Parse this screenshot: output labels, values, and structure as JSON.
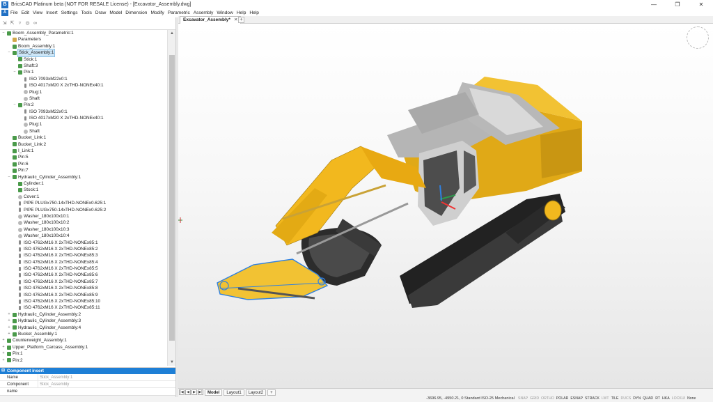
{
  "window": {
    "title": "BricsCAD Platinum beta (NOT FOR RESALE License) - [Excavator_Assembly.dwg]",
    "minimize": "—",
    "maximize": "❐",
    "close": "✕"
  },
  "menu": [
    "File",
    "Edit",
    "View",
    "Insert",
    "Settings",
    "Tools",
    "Draw",
    "Model",
    "Dimension",
    "Modify",
    "Parametric",
    "Assembly",
    "Window",
    "Help",
    "Help"
  ],
  "tree": {
    "rows": [
      {
        "label": "Boom_Assembly_Parametric:1",
        "depth": 0,
        "toggle": "−",
        "icon": "asm"
      },
      {
        "label": "Parameters",
        "depth": 1,
        "toggle": "",
        "icon": "folder"
      },
      {
        "label": "Boom_Assembly:1",
        "depth": 1,
        "toggle": "",
        "icon": "asm"
      },
      {
        "label": "Stick_Assembly:1",
        "depth": 1,
        "toggle": "−",
        "icon": "asm",
        "selected": true
      },
      {
        "label": "Stick:1",
        "depth": 2,
        "toggle": "",
        "icon": "asm"
      },
      {
        "label": "Shaft:3",
        "depth": 2,
        "toggle": "",
        "icon": "asm"
      },
      {
        "label": "Pin:1",
        "depth": 2,
        "toggle": "−",
        "icon": "asm"
      },
      {
        "label": "ISO 7093xM22x0:1",
        "depth": 3,
        "toggle": "",
        "icon": "bolt"
      },
      {
        "label": "ISO 4017xM20 X 2xTHD-NONEx40:1",
        "depth": 3,
        "toggle": "",
        "icon": "bolt"
      },
      {
        "label": "Plug:1",
        "depth": 3,
        "toggle": "",
        "icon": "part"
      },
      {
        "label": "Shaft",
        "depth": 3,
        "toggle": "",
        "icon": "part"
      },
      {
        "label": "Pin:2",
        "depth": 2,
        "toggle": "−",
        "icon": "asm"
      },
      {
        "label": "ISO 7093xM22x0:1",
        "depth": 3,
        "toggle": "",
        "icon": "bolt"
      },
      {
        "label": "ISO 4017xM20 X 2xTHD-NONEx40:1",
        "depth": 3,
        "toggle": "",
        "icon": "bolt"
      },
      {
        "label": "Plug:1",
        "depth": 3,
        "toggle": "",
        "icon": "part"
      },
      {
        "label": "Shaft",
        "depth": 3,
        "toggle": "",
        "icon": "part"
      },
      {
        "label": "Bucket_Link:1",
        "depth": 1,
        "toggle": "",
        "icon": "asm"
      },
      {
        "label": "Bucket_Link:2",
        "depth": 1,
        "toggle": "",
        "icon": "asm"
      },
      {
        "label": "I_Link:1",
        "depth": 1,
        "toggle": "",
        "icon": "asm"
      },
      {
        "label": "Pin:5",
        "depth": 1,
        "toggle": "",
        "icon": "asm"
      },
      {
        "label": "Pin:6",
        "depth": 1,
        "toggle": "",
        "icon": "asm"
      },
      {
        "label": "Pin:7",
        "depth": 1,
        "toggle": "",
        "icon": "asm"
      },
      {
        "label": "Hydraulic_Cylinder_Assembly:1",
        "depth": 1,
        "toggle": "−",
        "icon": "asm"
      },
      {
        "label": "Cylinder:1",
        "depth": 2,
        "toggle": "",
        "icon": "asm"
      },
      {
        "label": "Stock:1",
        "depth": 2,
        "toggle": "",
        "icon": "asm"
      },
      {
        "label": "Cover:1",
        "depth": 2,
        "toggle": "",
        "icon": "part"
      },
      {
        "label": "PIPE PLUGx750-14xTHD-NONEx0.625:1",
        "depth": 2,
        "toggle": "",
        "icon": "bolt"
      },
      {
        "label": "PIPE PLUGx750-14xTHD-NONEx0.625:2",
        "depth": 2,
        "toggle": "",
        "icon": "bolt"
      },
      {
        "label": "Washer_180x100x10:1",
        "depth": 2,
        "toggle": "",
        "icon": "part"
      },
      {
        "label": "Washer_180x100x10:2",
        "depth": 2,
        "toggle": "",
        "icon": "part"
      },
      {
        "label": "Washer_180x100x10:3",
        "depth": 2,
        "toggle": "",
        "icon": "part"
      },
      {
        "label": "Washer_180x100x10:4",
        "depth": 2,
        "toggle": "",
        "icon": "part"
      },
      {
        "label": "ISO 4762xM16 X 2xTHD-NONEx85:1",
        "depth": 2,
        "toggle": "",
        "icon": "bolt"
      },
      {
        "label": "ISO 4762xM16 X 2xTHD-NONEx85:2",
        "depth": 2,
        "toggle": "",
        "icon": "bolt"
      },
      {
        "label": "ISO 4762xM16 X 2xTHD-NONEx85:3",
        "depth": 2,
        "toggle": "",
        "icon": "bolt"
      },
      {
        "label": "ISO 4762xM16 X 2xTHD-NONEx85:4",
        "depth": 2,
        "toggle": "",
        "icon": "bolt"
      },
      {
        "label": "ISO 4762xM16 X 2xTHD-NONEx85:5",
        "depth": 2,
        "toggle": "",
        "icon": "bolt"
      },
      {
        "label": "ISO 4762xM16 X 2xTHD-NONEx85:6",
        "depth": 2,
        "toggle": "",
        "icon": "bolt"
      },
      {
        "label": "ISO 4762xM16 X 2xTHD-NONEx85:7",
        "depth": 2,
        "toggle": "",
        "icon": "bolt"
      },
      {
        "label": "ISO 4762xM16 X 2xTHD-NONEx85:8",
        "depth": 2,
        "toggle": "",
        "icon": "bolt"
      },
      {
        "label": "ISO 4762xM16 X 2xTHD-NONEx85:9",
        "depth": 2,
        "toggle": "",
        "icon": "bolt"
      },
      {
        "label": "ISO 4762xM16 X 2xTHD-NONEx85:10",
        "depth": 2,
        "toggle": "",
        "icon": "bolt"
      },
      {
        "label": "ISO 4762xM16 X 2xTHD-NONEx85:11",
        "depth": 2,
        "toggle": "",
        "icon": "bolt"
      },
      {
        "label": "Hydraulic_Cylinder_Assembly:2",
        "depth": 1,
        "toggle": "+",
        "icon": "asm"
      },
      {
        "label": "Hydraulic_Cylinder_Assembly:3",
        "depth": 1,
        "toggle": "+",
        "icon": "asm"
      },
      {
        "label": "Hydraulic_Cylinder_Assembly:4",
        "depth": 1,
        "toggle": "+",
        "icon": "asm"
      },
      {
        "label": "Bucket_Assembly:1",
        "depth": 1,
        "toggle": "+",
        "icon": "asm"
      },
      {
        "label": "Counterweight_Assembly:1",
        "depth": 0,
        "toggle": "+",
        "icon": "asm"
      },
      {
        "label": "Upper_Platform_Carcass_Assembly:1",
        "depth": 0,
        "toggle": "+",
        "icon": "asm"
      },
      {
        "label": "Pin:1",
        "depth": 0,
        "toggle": "+",
        "icon": "asm"
      },
      {
        "label": "Pin:2",
        "depth": 0,
        "toggle": "+",
        "icon": "asm"
      }
    ]
  },
  "properties": {
    "header": "Component insert",
    "rows": [
      {
        "key": "Name",
        "value": "Stick_Assembly:1"
      },
      {
        "key": "Component name",
        "value": "Stick_Assembly"
      }
    ]
  },
  "document_tab": {
    "label": "Excavator_Assembly*",
    "close": "✕",
    "add": "+"
  },
  "layouts": [
    "Model",
    "Layout1",
    "Layout2"
  ],
  "layout_add": "+",
  "status": {
    "coords": "-3696.95, -4950.21, 0   Standard   ISO-25   Mechanical",
    "toggles": [
      {
        "label": "SNAP",
        "on": false
      },
      {
        "label": "GRID",
        "on": false
      },
      {
        "label": "ORTHO",
        "on": false
      },
      {
        "label": "POLAR",
        "on": true
      },
      {
        "label": "ESNAP",
        "on": true
      },
      {
        "label": "STRACK",
        "on": true
      },
      {
        "label": "LWT",
        "on": false
      },
      {
        "label": "TILE",
        "on": true
      },
      {
        "label": "DUCS",
        "on": false
      },
      {
        "label": "DYN",
        "on": true
      },
      {
        "label": "QUAD",
        "on": true
      },
      {
        "label": "RT",
        "on": true
      },
      {
        "label": "HKA",
        "on": true
      },
      {
        "label": "LOCKUI",
        "on": false
      },
      {
        "label": "None",
        "on": true
      }
    ]
  },
  "colors": {
    "accent": "#1e7fd6",
    "machine_yellow": "#f2b81e",
    "track_dark": "#2b2b2b",
    "selection_blue": "#2f80e0"
  }
}
